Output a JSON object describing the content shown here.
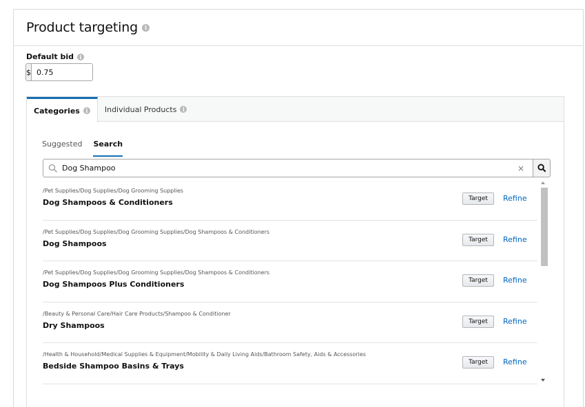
{
  "page": {
    "title": "Product targeting",
    "info_glyph": "i"
  },
  "bid": {
    "label": "Default bid",
    "currency": "$",
    "value": "0.75"
  },
  "main_tabs": [
    {
      "label": "Categories",
      "active": true
    },
    {
      "label": "Individual Products",
      "active": false
    }
  ],
  "sub_tabs": [
    {
      "label": "Suggested",
      "active": false
    },
    {
      "label": "Search",
      "active": true
    }
  ],
  "search": {
    "value": "Dog Shampoo",
    "clear_glyph": "×"
  },
  "results": [
    {
      "path": "/Pet Supplies/Dog Supplies/Dog Grooming Supplies",
      "name": "Dog Shampoos & Conditioners",
      "target_label": "Target",
      "refine_label": "Refine"
    },
    {
      "path": "/Pet Supplies/Dog Supplies/Dog Grooming Supplies/Dog Shampoos & Conditioners",
      "name": "Dog Shampoos",
      "target_label": "Target",
      "refine_label": "Refine"
    },
    {
      "path": "/Pet Supplies/Dog Supplies/Dog Grooming Supplies/Dog Shampoos & Conditioners",
      "name": "Dog Shampoos Plus Conditioners",
      "target_label": "Target",
      "refine_label": "Refine"
    },
    {
      "path": "/Beauty & Personal Care/Hair Care Products/Shampoo & Conditioner",
      "name": "Dry Shampoos",
      "target_label": "Target",
      "refine_label": "Refine"
    },
    {
      "path": "/Health & Household/Medical Supplies & Equipment/Mobility & Daily Living Aids/Bathroom Safety, Aids & Accessories",
      "name": "Bedside Shampoo Basins & Trays",
      "target_label": "Target",
      "refine_label": "Refine"
    }
  ],
  "colors": {
    "accent": "#146eb4",
    "link": "#0066c0",
    "border": "#dddddd"
  }
}
